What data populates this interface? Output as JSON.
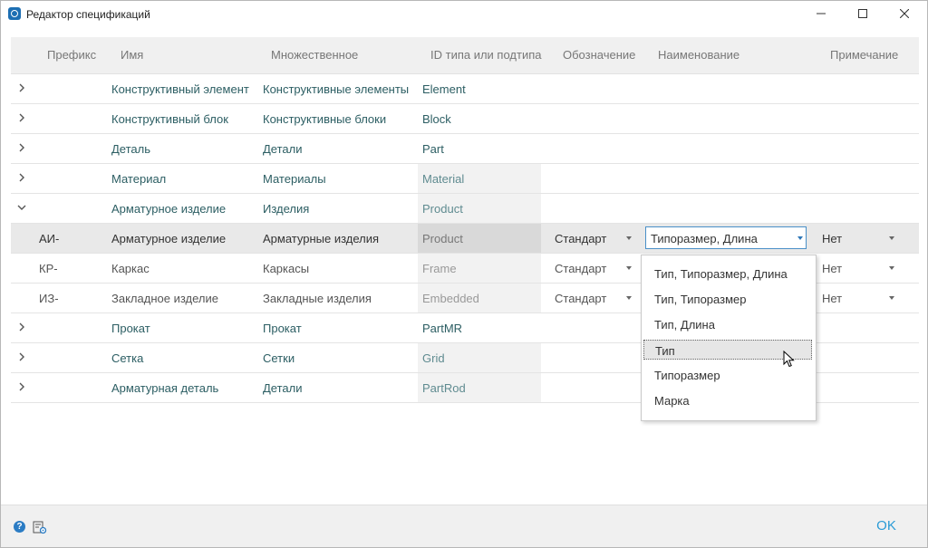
{
  "window": {
    "title": "Редактор спецификаций"
  },
  "columns": {
    "prefix": "Префикс",
    "name": "Имя",
    "plural": "Множественное",
    "type_id": "ID типа или подтипа",
    "designation": "Обозначение",
    "naming": "Наименование",
    "note": "Примечание"
  },
  "rows": [
    {
      "name": "Конструктивный элемент",
      "plural": "Конструктивные элементы",
      "type_id": "Element"
    },
    {
      "name": "Конструктивный блок",
      "plural": "Конструктивные блоки",
      "type_id": "Block"
    },
    {
      "name": "Деталь",
      "plural": "Детали",
      "type_id": "Part"
    },
    {
      "name": "Материал",
      "plural": "Материалы",
      "type_id": "Material"
    },
    {
      "name": "Арматурное изделие",
      "plural": "Изделия",
      "type_id": "Product"
    },
    {
      "prefix": "АИ-",
      "name": "Арматурное изделие",
      "plural": "Арматурные изделия",
      "type_id": "Product",
      "designation": "Стандарт",
      "naming": "Типоразмер, Длина",
      "note": "Нет"
    },
    {
      "prefix": "КР-",
      "name": "Каркас",
      "plural": "Каркасы",
      "type_id": "Frame",
      "designation": "Стандарт",
      "note": "Нет"
    },
    {
      "prefix": "ИЗ-",
      "name": "Закладное изделие",
      "plural": "Закладные изделия",
      "type_id": "Embedded",
      "designation": "Стандарт",
      "note": "Нет"
    },
    {
      "name": "Прокат",
      "plural": "Прокат",
      "type_id": "PartMR"
    },
    {
      "name": "Сетка",
      "plural": "Сетки",
      "type_id": "Grid"
    },
    {
      "name": "Арматурная деталь",
      "plural": "Детали",
      "type_id": "PartRod"
    }
  ],
  "dropdown": {
    "options": [
      "Тип, Типоразмер, Длина",
      "Тип, Типоразмер",
      "Тип, Длина",
      "Тип",
      "Типоразмер",
      "Марка"
    ]
  },
  "footer": {
    "ok_label": "OK"
  }
}
